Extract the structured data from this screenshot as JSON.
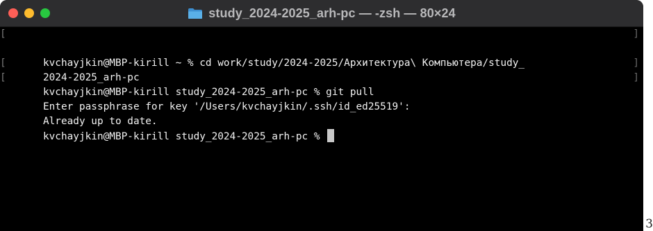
{
  "window": {
    "title": "study_2024-2025_arh-pc — -zsh — 80×24",
    "folder_icon": "folder-icon",
    "colors": {
      "close": "#ff5f57",
      "minimize": "#febc2e",
      "zoom": "#28c840",
      "folder": "#5ab0e8",
      "background": "#000000",
      "text": "#f2f2f2"
    }
  },
  "terminal": {
    "lines": [
      {
        "left_mark": "[",
        "text": "kvchayjkin@MBP-kirill ~ % cd work/study/2024-2025/Архитектура\\ Компьютера/study_",
        "right_mark": "]"
      },
      {
        "left_mark": "",
        "text": "2024-2025_arh-pc",
        "right_mark": ""
      },
      {
        "left_mark": "[",
        "text": "kvchayjkin@MBP-kirill study_2024-2025_arh-pc % git pull",
        "right_mark": "]"
      },
      {
        "left_mark": "[",
        "text": "Enter passphrase for key '/Users/kvchayjkin/.ssh/id_ed25519':",
        "right_mark": "]"
      },
      {
        "left_mark": "",
        "text": "Already up to date.",
        "right_mark": ""
      },
      {
        "left_mark": "",
        "text": "kvchayjkin@MBP-kirill study_2024-2025_arh-pc % ",
        "right_mark": ""
      }
    ]
  },
  "page_number": "3"
}
